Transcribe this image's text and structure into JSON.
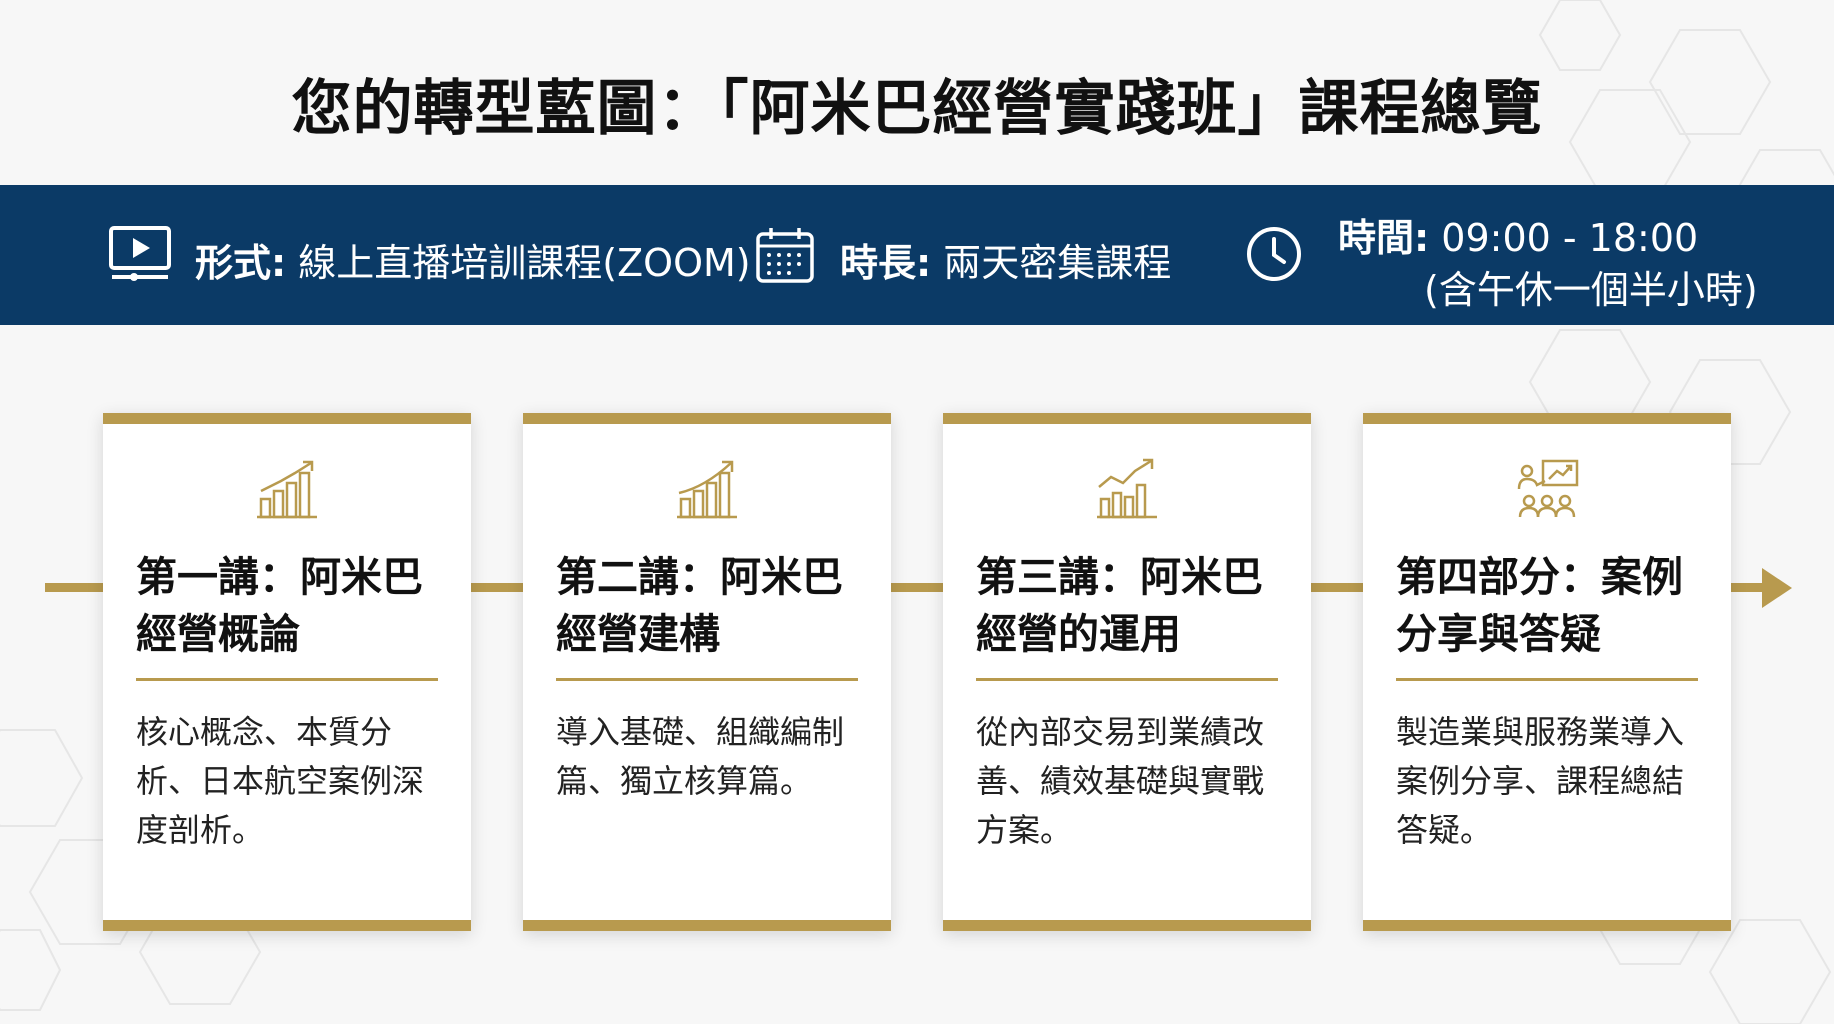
{
  "title": "您的轉型藍圖：「阿米巴經營實踐班」課程總覽",
  "banner": {
    "format_label": "形式:",
    "format_value": "線上直播培訓課程(ZOOM)",
    "duration_label": "時長:",
    "duration_value": "兩天密集課程",
    "time_label": "時間:",
    "time_value": "09:00 - 18:00",
    "time_note": "(含午休一個半小時)",
    "background_color": "#0b3a66"
  },
  "accent_color": "#b89a4e",
  "cards": [
    {
      "icon": "bar-chart-growth-icon",
      "title": "第一講：阿米巴經營概論",
      "desc": "核心概念、本質分析、日本航空案例深度剖析。"
    },
    {
      "icon": "bar-chart-growth-icon",
      "title": "第二講：阿米巴經營建構",
      "desc": "導入基礎、組織編制篇、獨立核算篇。"
    },
    {
      "icon": "line-chart-trend-icon",
      "title": "第三講：阿米巴經營的運用",
      "desc": "從內部交易到業績改善、績效基礎與實戰方案。"
    },
    {
      "icon": "team-presentation-icon",
      "title": "第四部分：案例分享與答疑",
      "desc": "製造業與服務業導入案例分享、課程總結答疑。"
    }
  ]
}
